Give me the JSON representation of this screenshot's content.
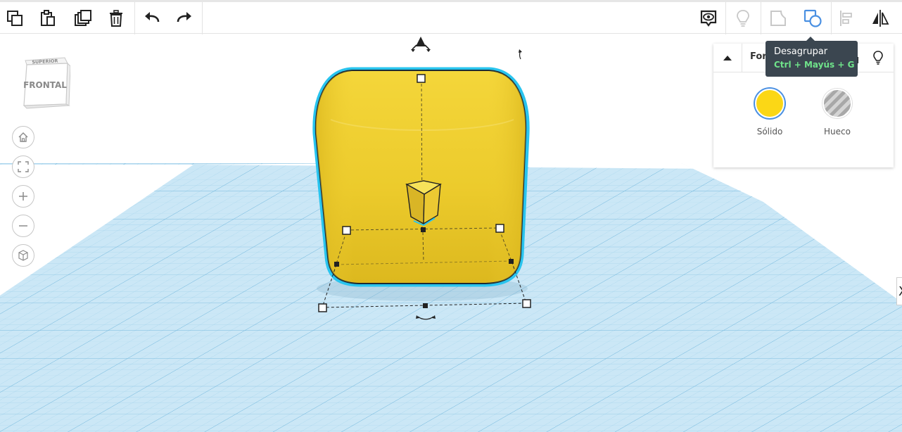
{
  "toolbar": {
    "left_icons": [
      "copy-icon",
      "paste-icon",
      "duplicate-icon",
      "trash-icon",
      "undo-icon",
      "redo-icon"
    ],
    "right_icons": [
      "notes-eye-icon",
      "light-bulb-icon",
      "group-icon",
      "ungroup-icon",
      "align-icon",
      "mirror-icon"
    ]
  },
  "view_cube": {
    "top_label": "SUPERIOR",
    "front_label": "FRONTAL"
  },
  "nav_icons": [
    "home-icon",
    "fit-view-icon",
    "zoom-in-icon",
    "zoom-out-icon",
    "perspective-icon"
  ],
  "panel": {
    "title": "Forma",
    "options": [
      {
        "label": "Sólido",
        "color": "#fbd716",
        "selected": true
      },
      {
        "label": "Hueco",
        "color": "#a8a8a8",
        "selected": false
      }
    ]
  },
  "tooltip": {
    "title": "Desagrupar",
    "shortcut": "Ctrl + Mayús + G"
  },
  "edge_label": "X",
  "colors": {
    "shape": "#f0cf33",
    "selection": "#29c4ee",
    "grid_bg": "#cbe7f6",
    "grid_line": "#7fc1e3",
    "accent": "#4a90e2"
  }
}
